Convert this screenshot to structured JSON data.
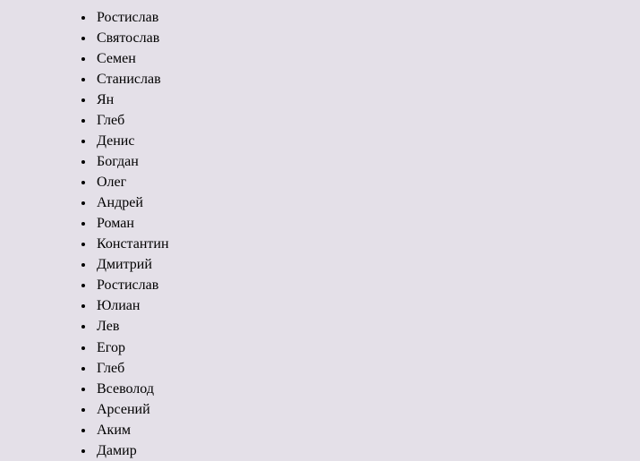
{
  "names": [
    "Ростислав",
    "Святослав",
    "Семен",
    "Станислав",
    "Ян",
    "Глеб",
    "Денис",
    "Богдан",
    "Олег",
    "Андрей",
    "Роман",
    "Константин",
    "Дмитрий",
    "Ростислав",
    "Юлиан",
    "Лев",
    "Егор",
    "Глеб",
    "Всеволод",
    "Арсений",
    "Аким",
    "Дамир"
  ]
}
